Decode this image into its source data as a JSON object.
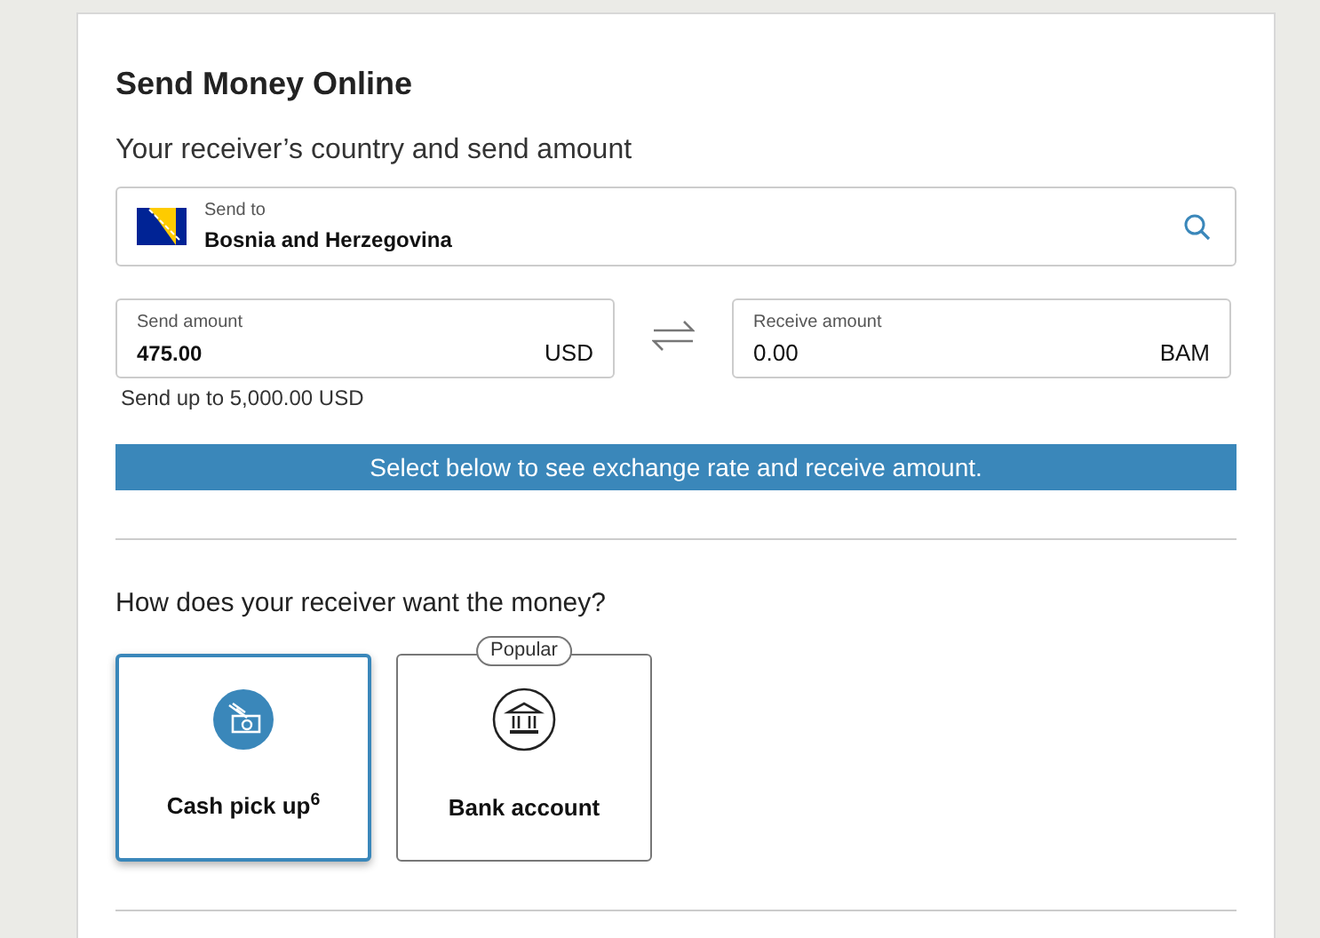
{
  "title": "Send Money Online",
  "subtitle": "Your receiver’s country and send amount",
  "country": {
    "label": "Send to",
    "value": "Bosnia and Herzegovina"
  },
  "send": {
    "label": "Send amount",
    "value": "475.00",
    "currency": "USD",
    "hint": "Send up to 5,000.00 USD"
  },
  "receive": {
    "label": "Receive amount",
    "value": "0.00",
    "currency": "BAM"
  },
  "banner": "Select below to see exchange rate and receive amount.",
  "question": "How does your receiver want the money?",
  "options": [
    {
      "kind": "cash",
      "label": "Cash pick up$^{6}$",
      "selected": true
    },
    {
      "kind": "bank",
      "label": "Bank account",
      "badge": "Popular",
      "selected": false
    }
  ]
}
